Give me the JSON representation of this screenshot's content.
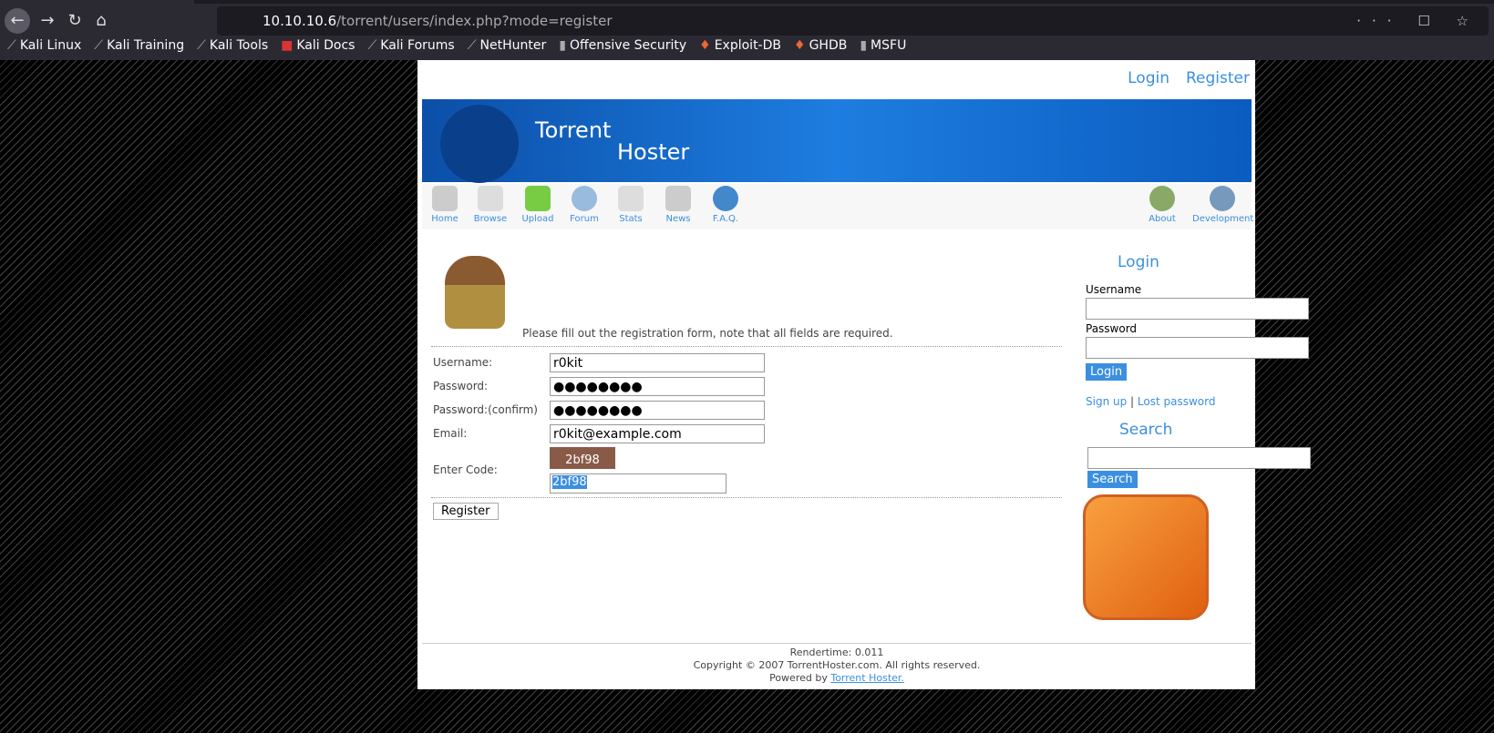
{
  "browser": {
    "url_host": "10.10.10.6",
    "url_path": "/torrent/users/index.php?mode=register",
    "bookmarks": [
      "Kali Linux",
      "Kali Training",
      "Kali Tools",
      "Kali Docs",
      "Kali Forums",
      "NetHunter",
      "Offensive Security",
      "Exploit-DB",
      "GHDB",
      "MSFU"
    ]
  },
  "header": {
    "login": "Login",
    "register": "Register",
    "title1": "Torrent",
    "title2": "Hoster"
  },
  "nav": {
    "left": [
      "Home",
      "Browse",
      "Upload",
      "Forum",
      "Stats",
      "News",
      "F.A.Q."
    ],
    "right": [
      "About",
      "Development"
    ]
  },
  "form": {
    "intro": "Please fill out the registration form, note that all fields are required.",
    "username_label": "Username:",
    "username": "r0kit",
    "password_label": "Password:",
    "password": "●●●●●●●●",
    "confirm_label": "Password:(confirm)",
    "confirm": "●●●●●●●●",
    "email_label": "Email:",
    "email": "r0kit@example.com",
    "code_label": "Enter Code:",
    "captcha": "2bf98",
    "code": "2bf98",
    "submit": "Register"
  },
  "sidebar": {
    "login_title": "Login",
    "username_label": "Username",
    "password_label": "Password",
    "login_button": "Login",
    "signup": "Sign up",
    "sep": " | ",
    "lost": "Lost password",
    "search_title": "Search",
    "search_button": "Search"
  },
  "footer": {
    "render": "Rendertime: 0.011",
    "copyright": "Copyright © 2007 TorrentHoster.com. All rights reserved.",
    "powered": "Powered by ",
    "powered_link": "Torrent Hoster."
  }
}
